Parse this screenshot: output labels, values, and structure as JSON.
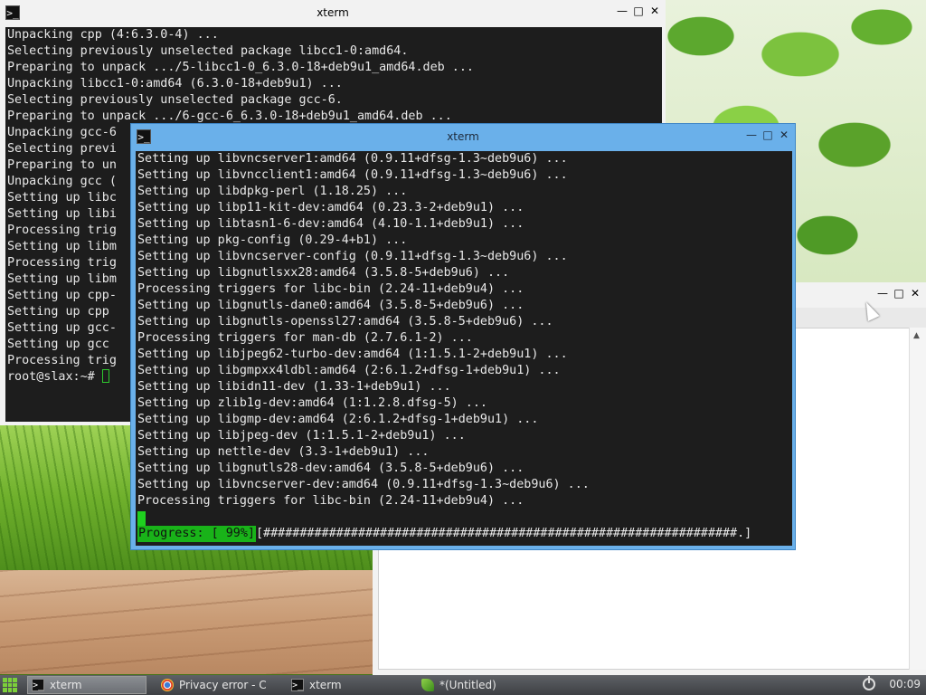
{
  "window_back": {
    "title": "xterm",
    "lines": [
      "Unpacking cpp (4:6.3.0-4) ...",
      "Selecting previously unselected package libcc1-0:amd64.",
      "Preparing to unpack .../5-libcc1-0_6.3.0-18+deb9u1_amd64.deb ...",
      "Unpacking libcc1-0:amd64 (6.3.0-18+deb9u1) ...",
      "Selecting previously unselected package gcc-6.",
      "Preparing to unpack .../6-gcc-6_6.3.0-18+deb9u1_amd64.deb ...",
      "Unpacking gcc-6",
      "Selecting previ",
      "Preparing to un",
      "Unpacking gcc (",
      "Setting up libc",
      "Setting up libi",
      "Processing trig",
      "Setting up libm",
      "Processing trig",
      "Setting up libm",
      "Setting up cpp-",
      "Setting up cpp",
      "Setting up gcc-",
      "Setting up gcc",
      "Processing trig"
    ],
    "prompt": "root@slax:~#"
  },
  "window_front": {
    "title": "xterm",
    "lines": [
      "Setting up libvncserver1:amd64 (0.9.11+dfsg-1.3~deb9u6) ...",
      "Setting up libvncclient1:amd64 (0.9.11+dfsg-1.3~deb9u6) ...",
      "Setting up libdpkg-perl (1.18.25) ...",
      "Setting up libp11-kit-dev:amd64 (0.23.3-2+deb9u1) ...",
      "Setting up libtasn1-6-dev:amd64 (4.10-1.1+deb9u1) ...",
      "Setting up pkg-config (0.29-4+b1) ...",
      "Setting up libvncserver-config (0.9.11+dfsg-1.3~deb9u6) ...",
      "Setting up libgnutlsxx28:amd64 (3.5.8-5+deb9u6) ...",
      "Processing triggers for libc-bin (2.24-11+deb9u4) ...",
      "Setting up libgnutls-dane0:amd64 (3.5.8-5+deb9u6) ...",
      "Setting up libgnutls-openssl27:amd64 (3.5.8-5+deb9u6) ...",
      "Processing triggers for man-db (2.7.6.1-2) ...",
      "Setting up libjpeg62-turbo-dev:amd64 (1:1.5.1-2+deb9u1) ...",
      "Setting up libgmpxx4ldbl:amd64 (2:6.1.2+dfsg-1+deb9u1) ...",
      "Setting up libidn11-dev (1.33-1+deb9u1) ...",
      "Setting up zlib1g-dev:amd64 (1:1.2.8.dfsg-5) ...",
      "Setting up libgmp-dev:amd64 (2:6.1.2+dfsg-1+deb9u1) ...",
      "Setting up libjpeg-dev (1:1.5.1-2+deb9u1) ...",
      "Setting up nettle-dev (3.3-1+deb9u1) ...",
      "Setting up libgnutls28-dev:amd64 (3.5.8-5+deb9u6) ...",
      "Setting up libvncserver-dev:amd64 (0.9.11+dfsg-1.3~deb9u6) ...",
      "Processing triggers for libc-bin (2.24-11+deb9u4) ..."
    ],
    "progress_label": "Progress: [ 99%]",
    "progress_bar": "[#################################################################.]",
    "progress_fraction": 0.99
  },
  "taskbar": {
    "tasks": [
      {
        "label": "xterm",
        "icon": "terminal-icon",
        "active": true
      },
      {
        "label": "Privacy error - C",
        "icon": "chrome-icon",
        "active": false
      },
      {
        "label": "xterm",
        "icon": "terminal-icon",
        "active": false
      },
      {
        "label": "*(Untitled)",
        "icon": "leafpad-icon",
        "active": false
      }
    ],
    "clock": "00:09"
  },
  "colors": {
    "terminal_bg": "#1d1d1d",
    "progress_green": "#19b319",
    "active_titlebar": "#6ab0ea"
  }
}
